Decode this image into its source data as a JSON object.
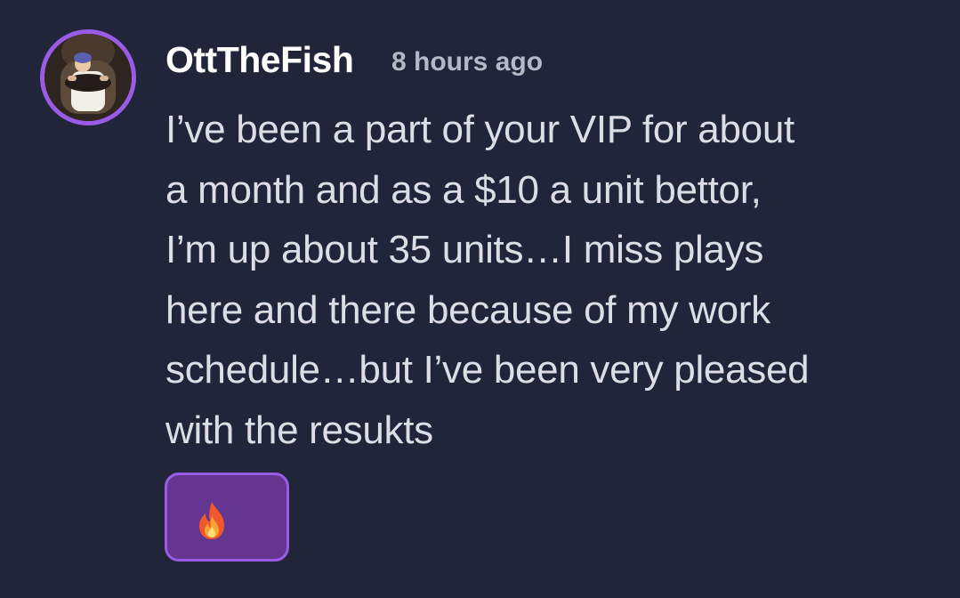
{
  "message": {
    "username": "OttTheFish",
    "timestamp": "8 hours ago",
    "text": "I’ve been a part of your VIP for about\na month and as a $10 a unit bettor,\nI’m up about 35 units…I miss plays\nhere and there because of my work\nschedule…but I’ve been very pleased\nwith the resukts",
    "avatar_icon": "user-avatar-photo"
  },
  "reactions": [
    {
      "icon": "fire-emoji-icon",
      "count": null
    }
  ],
  "colors": {
    "background": "#21253a",
    "accent": "#9a5ce6",
    "reaction_bg": "#65368f",
    "username": "#ffffff",
    "timestamp": "#b6b8c6",
    "text": "#dcdde5"
  }
}
